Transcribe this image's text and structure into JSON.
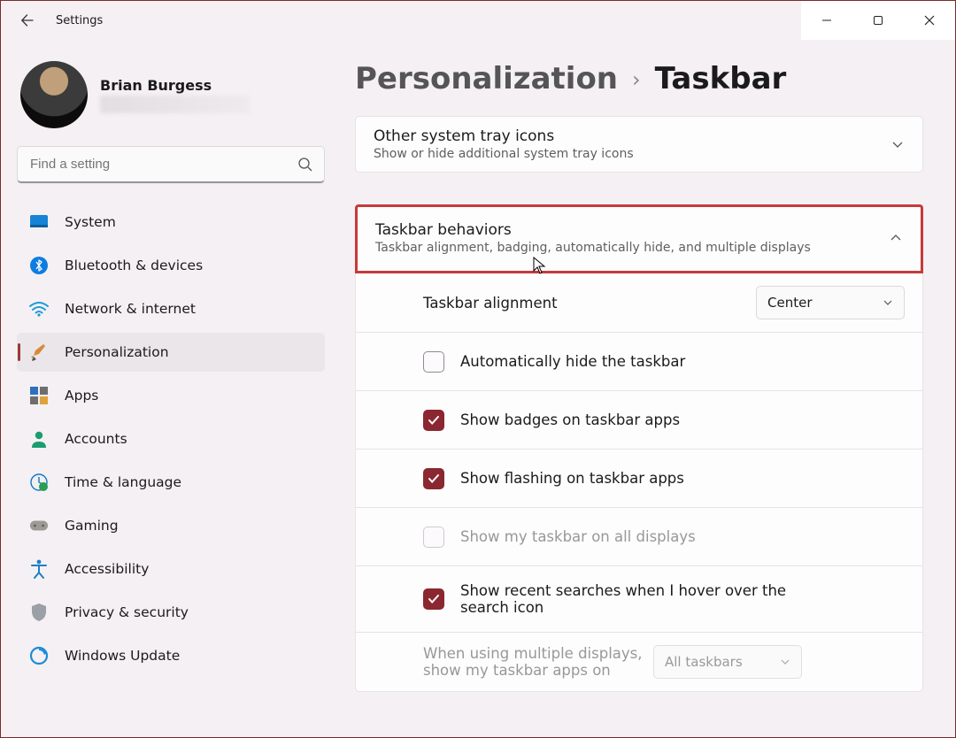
{
  "titlebar": {
    "title": "Settings"
  },
  "profile": {
    "name": "Brian Burgess"
  },
  "search": {
    "placeholder": "Find a setting"
  },
  "nav": {
    "items": [
      {
        "id": "system",
        "label": "System"
      },
      {
        "id": "bluetooth",
        "label": "Bluetooth & devices"
      },
      {
        "id": "network",
        "label": "Network & internet"
      },
      {
        "id": "personalization",
        "label": "Personalization"
      },
      {
        "id": "apps",
        "label": "Apps"
      },
      {
        "id": "accounts",
        "label": "Accounts"
      },
      {
        "id": "time",
        "label": "Time & language"
      },
      {
        "id": "gaming",
        "label": "Gaming"
      },
      {
        "id": "accessibility",
        "label": "Accessibility"
      },
      {
        "id": "privacy",
        "label": "Privacy & security"
      },
      {
        "id": "update",
        "label": "Windows Update"
      }
    ]
  },
  "breadcrumb": {
    "parent": "Personalization",
    "current": "Taskbar"
  },
  "panels": {
    "other_tray": {
      "title": "Other system tray icons",
      "sub": "Show or hide additional system tray icons"
    },
    "behaviors": {
      "title": "Taskbar behaviors",
      "sub": "Taskbar alignment, badging, automatically hide, and multiple displays",
      "alignment_label": "Taskbar alignment",
      "alignment_value": "Center",
      "opt_autohide": "Automatically hide the taskbar",
      "opt_badges": "Show badges on taskbar apps",
      "opt_flashing": "Show flashing on taskbar apps",
      "opt_alldisplays": "Show my taskbar on all displays",
      "opt_recent": "Show recent searches when I hover over the search icon",
      "multi_label": "When using multiple displays, show my taskbar apps on",
      "multi_value": "All taskbars"
    }
  }
}
